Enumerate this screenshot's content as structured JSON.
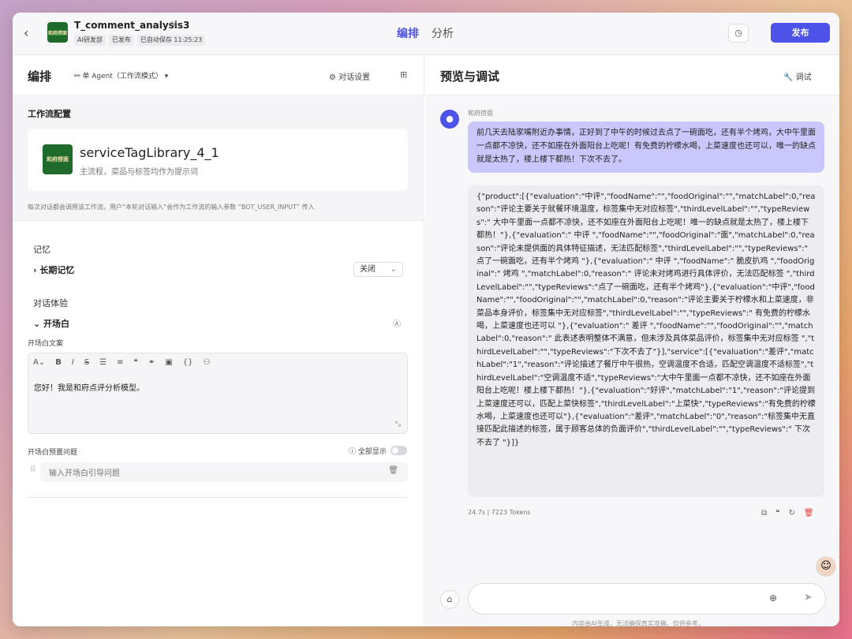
{
  "topbar": {
    "back_icon": "chevron-left-icon",
    "logo_text": "和府捞面",
    "title": "T_comment_analysis3",
    "chips": [
      "AI研发部",
      "已发布",
      "已自动保存 11:25:23"
    ],
    "tabs": [
      "编排",
      "分析"
    ],
    "active_tab": "编排",
    "history_icon": "history-icon",
    "publish_label": "发布",
    "accent_color": "#4d53e8"
  },
  "left": {
    "title": "编排",
    "agent_mode": "单 Agent（工作流模式）",
    "conv_settings": "对话设置",
    "workflow_config_title": "工作流配置",
    "workflow": {
      "name": "serviceTagLibrary_4_1",
      "desc": "主流程，菜品与标签均作为提示词",
      "logo_text": "和府捞面"
    },
    "workflow_note": "每次对话都会调用该工作流，用户“本轮对话输入”会作为工作流的输入参数 “BOT_USER_INPUT” 传入",
    "memory_title": "记忆",
    "long_term_memory": "长期记忆",
    "long_term_memory_value": "关闭",
    "conv_exp_title": "对话体验",
    "opening": "开场白",
    "opening_text_label": "开场白文案",
    "opening_text": "您好！我是和府点评分析模型。",
    "preset_label": "开场白预置问题",
    "show_all": "全部显示",
    "preset_placeholder": "输入开场白引导问题"
  },
  "right": {
    "title": "预览与调试",
    "debug": "调试",
    "user_name": "和府捞面",
    "user_message": "前几天去陆家嘴附近办事情，正好到了中午的时候过去点了一碗面吃，还有半个烤鸡，大中午里面一点都不凉快，还不如座在外面阳台上吃呢！有免费的柠檬水喝，上菜速度也还可以，唯一的缺点就是太热了，楼上楼下都热！下次不去了。",
    "bot_message": "{\"product\":[{\"evaluation\":\"中评\",\"foodName\":\"\",\"foodOriginal\":\"\",\"matchLabel\":0,\"reason\":\"评论主要关于就餐环境温度，标签集中无对应标签\",\"thirdLevelLabel\":\"\",\"typeReviews\":\" 大中午里面一点都不凉快，还不如座在外面阳台上吃呢！唯一的缺点就是太热了，楼上楼下都热！\"},{\"evaluation\":\" 中评 \",\"foodName\":\"\",\"foodOriginal\":\"面\",\"matchLabel\":0,\"reason\":\"评论未提供面的具体特征描述，无法匹配标签\",\"thirdLevelLabel\":\"\",\"typeReviews\":\" 点了一碗面吃，还有半个烤鸡 \"},{\"evaluation\":\" 中评 \",\"foodName\":\" 脆皮扒鸡 \",\"foodOriginal\":\" 烤鸡 \",\"matchLabel\":0,\"reason\":\" 评论未对烤鸡进行具体评价，无法匹配标签 \",\"thirdLevelLabel\":\"\",\"typeReviews\":\"点了一碗面吃，还有半个烤鸡\"},{\"evaluation\":\"中评\",\"foodName\":\"\",\"foodOriginal\":\"\",\"matchLabel\":0,\"reason\":\"评论主要关于柠檬水和上菜速度，非菜品本身评价，标签集中无对应标签\",\"thirdLevelLabel\":\"\",\"typeReviews\":\" 有免费的柠檬水喝，上菜速度也还可以 \"},{\"evaluation\":\" 差评 \",\"foodName\":\"\",\"foodOriginal\":\"\",\"matchLabel\":0,\"reason\":\" 此表述表明整体不满意，但未涉及具体菜品评价，标签集中无对应标签 \",\"thirdLevelLabel\":\"\",\"typeReviews\":\"下次不去了\"}],\"service\":[{\"evaluation\":\"差评\",\"matchLabel\":\"1\",\"reason\":\"评论描述了餐厅中午很热，空调温度不合适，匹配空调温度不适标签\",\"thirdLevelLabel\":\"空调温度不适\",\"typeReviews\":\"大中午里面一点都不凉快，还不如座在外面阳台上吃呢！楼上楼下都热！\"},{\"evaluation\":\"好评\",\"matchLabel\":\"1\",\"reason\":\"评论提到上菜速度还可以，匹配上菜快标签\",\"thirdLevelLabel\":\"上菜快\",\"typeReviews\":\"有免费的柠檬水喝，上菜速度也还可以\"},{\"evaluation\":\"差评\",\"matchLabel\":\"0\",\"reason\":\"标签集中无直接匹配此描述的标签，属于顾客总体的负面评价\",\"thirdLevelLabel\":\"\",\"typeReviews\":\" 下次不去了 \"}]}",
    "meta": "24.7s | 7223 Tokens",
    "disclaimer": "内容由AI生成，无法确保真实准确，仅供参考。"
  }
}
